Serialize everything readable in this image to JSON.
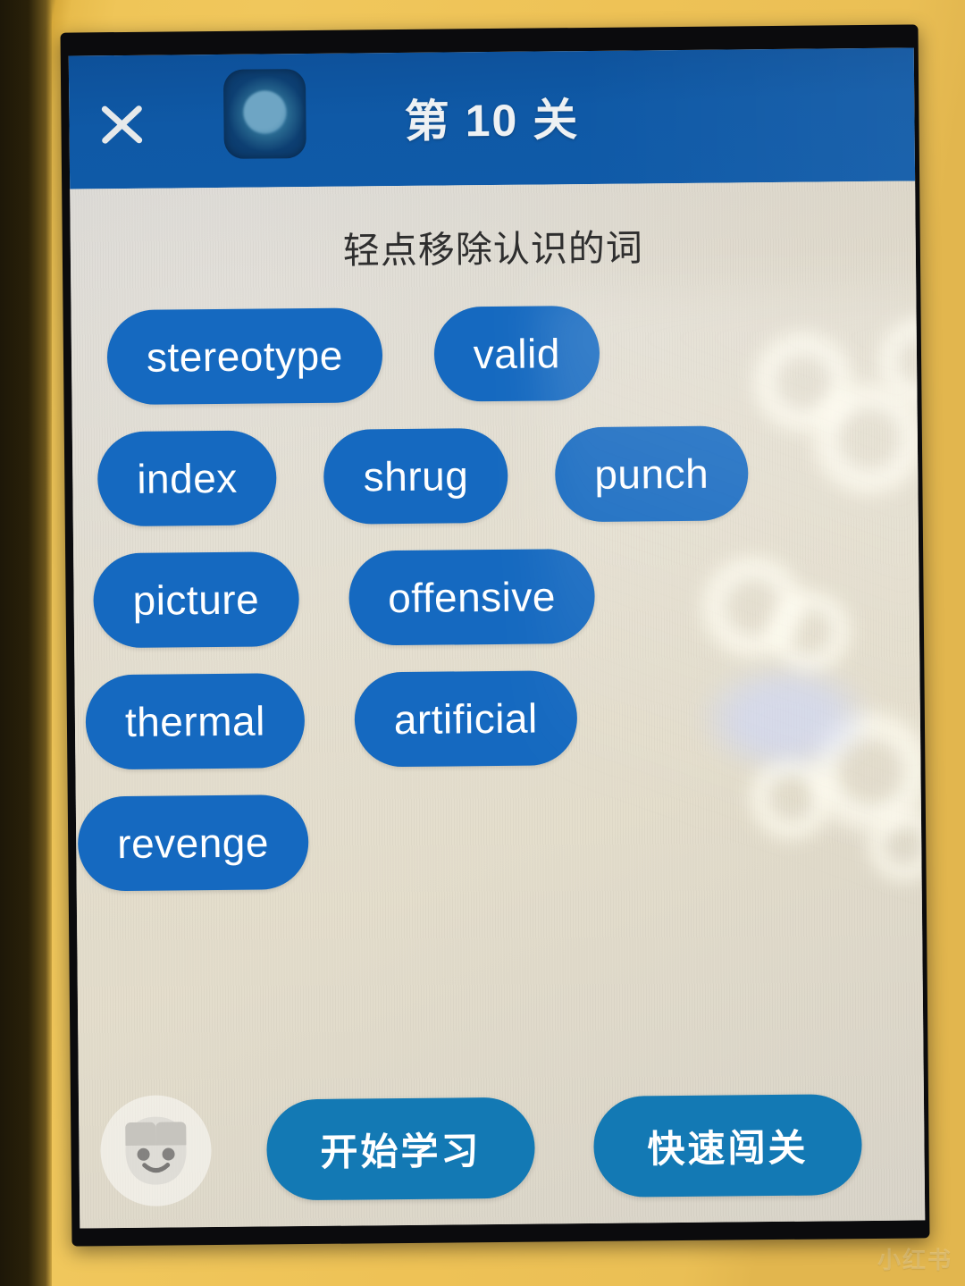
{
  "appbar": {
    "title": "第 10 关",
    "close_icon": "close-x-icon",
    "lens_icon": "camera-lens-artifact"
  },
  "content": {
    "subtitle": "轻点移除认识的词"
  },
  "word_rows": [
    {
      "words": [
        "stereotype",
        "valid"
      ]
    },
    {
      "words": [
        "index",
        "shrug",
        "punch"
      ]
    },
    {
      "words": [
        "picture",
        "offensive"
      ]
    },
    {
      "words": [
        "thermal",
        "artificial"
      ]
    },
    {
      "words": [
        "revenge"
      ]
    }
  ],
  "words_flat": [
    "stereotype",
    "valid",
    "index",
    "shrug",
    "punch",
    "picture",
    "offensive",
    "thermal",
    "artificial",
    "revenge"
  ],
  "bottom_bar": {
    "mascot_icon": "robot-face-icon",
    "start_label": "开始学习",
    "quick_label": "快速闯关"
  },
  "watermark": {
    "text": "小红书"
  },
  "colors": {
    "appbar_blue": "#0f59a6",
    "chip_blue": "#1569c0",
    "action_blue": "#1379b4",
    "screen_bg": "#dcdad5",
    "photo_yellow": "#efc558",
    "bezel_black": "#0b0b0d",
    "chip_text": "#ffffff",
    "subtitle_text": "#2e2e2e"
  }
}
